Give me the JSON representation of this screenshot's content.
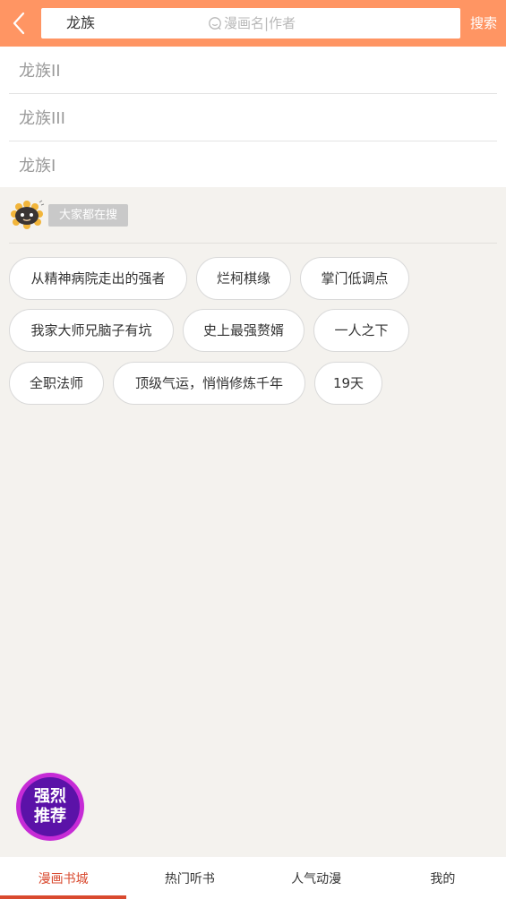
{
  "header": {
    "search_value": "龙族",
    "search_placeholder": "漫画名|作者",
    "search_button": "搜索"
  },
  "suggestions": [
    "龙族II",
    "龙族III",
    "龙族I"
  ],
  "hot": {
    "title": "大家都在搜",
    "tags": [
      "从精神病院走出的强者",
      "烂柯棋缘",
      "掌门低调点",
      "我家大师兄脑子有坑",
      "史上最强赘婿",
      "一人之下",
      "全职法师",
      "顶级气运，悄悄修炼千年",
      "19天"
    ]
  },
  "promo": {
    "line1": "强烈",
    "line2": "推荐"
  },
  "bottom_nav": {
    "items": [
      "漫画书城",
      "热门听书",
      "人气动漫",
      "我的"
    ],
    "active_index": 0
  },
  "colors": {
    "header_bg": "#ff9563",
    "active": "#d94a2f",
    "promo_ring": "#c62bd6",
    "promo_fill": "#5b12a8"
  }
}
